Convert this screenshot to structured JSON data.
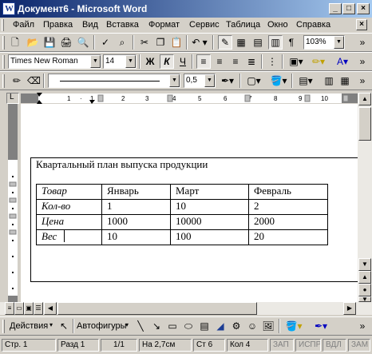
{
  "window": {
    "title": "Документ6 - Microsoft Word",
    "app_icon": "word-doc-icon"
  },
  "menu": [
    "Файл",
    "Правка",
    "Вид",
    "Вставка",
    "Формат",
    "Сервис",
    "Таблица",
    "Окно",
    "Справка"
  ],
  "toolbar": {
    "zoom": "103%"
  },
  "formatting": {
    "font": "Times New Roman",
    "size": "14",
    "bold": "Ж",
    "italic": "К",
    "underline": "Ч"
  },
  "borders": {
    "width": "0,5"
  },
  "drawing": {
    "actions": "Действия",
    "autoshapes": "Автофигуры"
  },
  "document": {
    "heading": "Квартальный план выпуска продукции",
    "table": [
      [
        "Товар",
        "Январь",
        "Март",
        "Февраль"
      ],
      [
        "Кол-во",
        "1",
        "10",
        "2"
      ],
      [
        "Цена",
        "1000",
        "10000",
        "2000"
      ],
      [
        "Вес",
        "10",
        "100",
        "20"
      ]
    ]
  },
  "status": {
    "page": "Стр. 1",
    "section": "Разд 1",
    "pages": "1/1",
    "at": "На 2,7см",
    "line": "Ст 6",
    "col": "Кол 4",
    "rec": "ЗАП",
    "trk": "ИСПР",
    "ext": "ВДЛ",
    "ovr": "ЗАМ"
  }
}
